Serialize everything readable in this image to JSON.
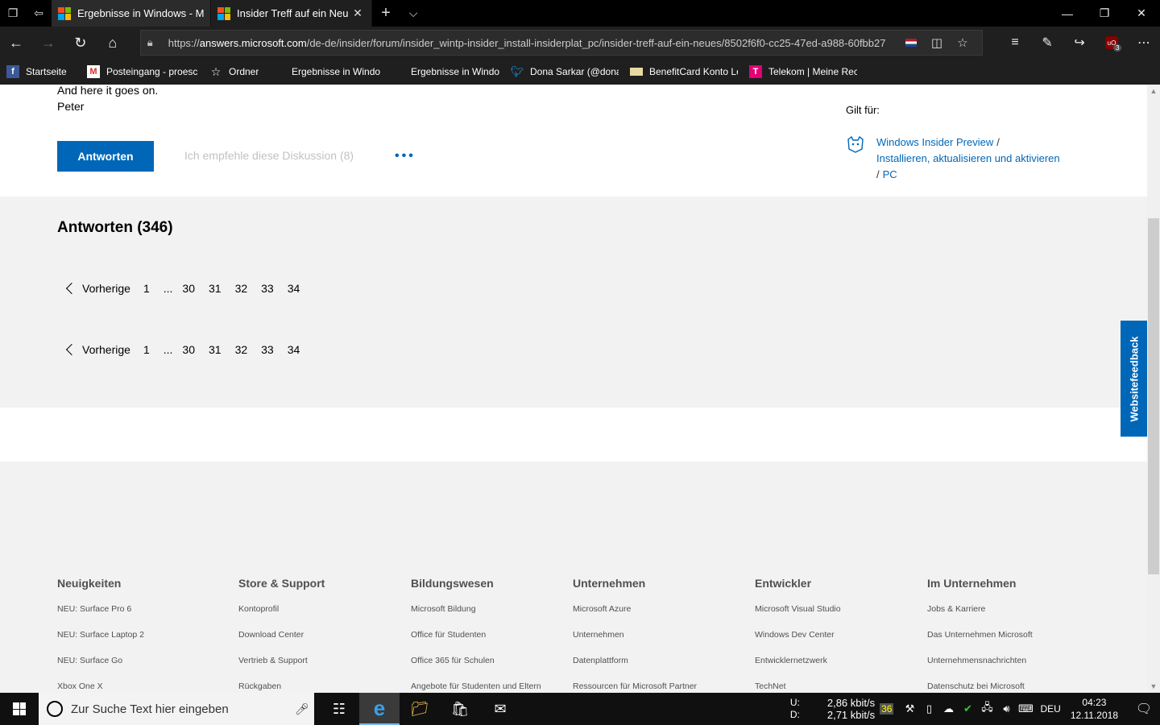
{
  "browser": {
    "tabs": [
      {
        "title": "Ergebnisse in Windows - Mi",
        "active": false
      },
      {
        "title": "Insider Treff auf ein Neu",
        "active": true
      }
    ],
    "url_host": "answers.microsoft.com",
    "url_prefix": "https://",
    "url_path": "/de-de/insider/forum/insider_wintp-insider_install-insiderplat_pc/insider-treff-auf-ein-neues/8502f6f0-cc25-47ed-a988-60fbb27",
    "ublock_count": "3"
  },
  "favorites": [
    {
      "label": "Startseite",
      "icon": "facebook-icon"
    },
    {
      "label": "Posteingang - proesc",
      "icon": "gmail-icon"
    },
    {
      "label": "Ordner",
      "icon": "star-folder-icon"
    },
    {
      "label": "Ergebnisse in Windov",
      "icon": "ms-logo-icon"
    },
    {
      "label": "Ergebnisse in Windov",
      "icon": "ms-logo-icon"
    },
    {
      "label": "Dona Sarkar (@dona:",
      "icon": "twitter-icon"
    },
    {
      "label": "BenefitCard Konto Lo",
      "icon": "card-icon"
    },
    {
      "label": "Telekom | Meine Rech",
      "icon": "telekom-icon"
    }
  ],
  "post": {
    "line1": "And here it goes on.",
    "line2": "Peter",
    "reply_label": "Antworten",
    "recommend_label": "Ich empfehle diese Diskussion (8)",
    "more_label": "..."
  },
  "applies": {
    "label": "Gilt für:",
    "link1": "Windows Insider Preview",
    "link2": "Installieren, aktualisieren und aktivieren",
    "link3": "PC",
    "sep": "/"
  },
  "answers": {
    "title": "Antworten (346)",
    "prev_label": "Vorherige",
    "pages": [
      "1",
      "...",
      "30",
      "31",
      "32",
      "33",
      "34"
    ]
  },
  "feedback_label": "Websitefeedback",
  "footer": [
    {
      "heading": "Neuigkeiten",
      "links": [
        "NEU: Surface Pro 6",
        "NEU: Surface Laptop 2",
        "NEU: Surface Go",
        "Xbox One X"
      ]
    },
    {
      "heading": "Store & Support",
      "links": [
        "Kontoprofil",
        "Download Center",
        "Vertrieb & Support",
        "Rückgaben"
      ]
    },
    {
      "heading": "Bildungswesen",
      "links": [
        "Microsoft Bildung",
        "Office für Studenten",
        "Office 365 für Schulen",
        "Angebote für Studenten und Eltern"
      ]
    },
    {
      "heading": "Unternehmen",
      "links": [
        "Microsoft Azure",
        "Unternehmen",
        "Datenplattform",
        "Ressourcen für Microsoft Partner"
      ]
    },
    {
      "heading": "Entwickler",
      "links": [
        "Microsoft Visual Studio",
        "Windows Dev Center",
        "Entwicklernetzwerk",
        "TechNet"
      ]
    },
    {
      "heading": "Im Unternehmen",
      "links": [
        "Jobs & Karriere",
        "Das Unternehmen Microsoft",
        "Unternehmensnachrichten",
        "Datenschutz bei Microsoft"
      ]
    }
  ],
  "taskbar": {
    "search_placeholder": "Zur Suche Text hier eingeben",
    "net_up_label": "U:",
    "net_down_label": "D:",
    "net_up": "2,86 kbit/s",
    "net_down": "2,71 kbit/s",
    "temp": "36",
    "lang": "DEU",
    "time": "04:23",
    "date": "12.11.2018"
  },
  "colors": {
    "accent": "#0067b8",
    "page_gray": "#f2f2f2"
  }
}
